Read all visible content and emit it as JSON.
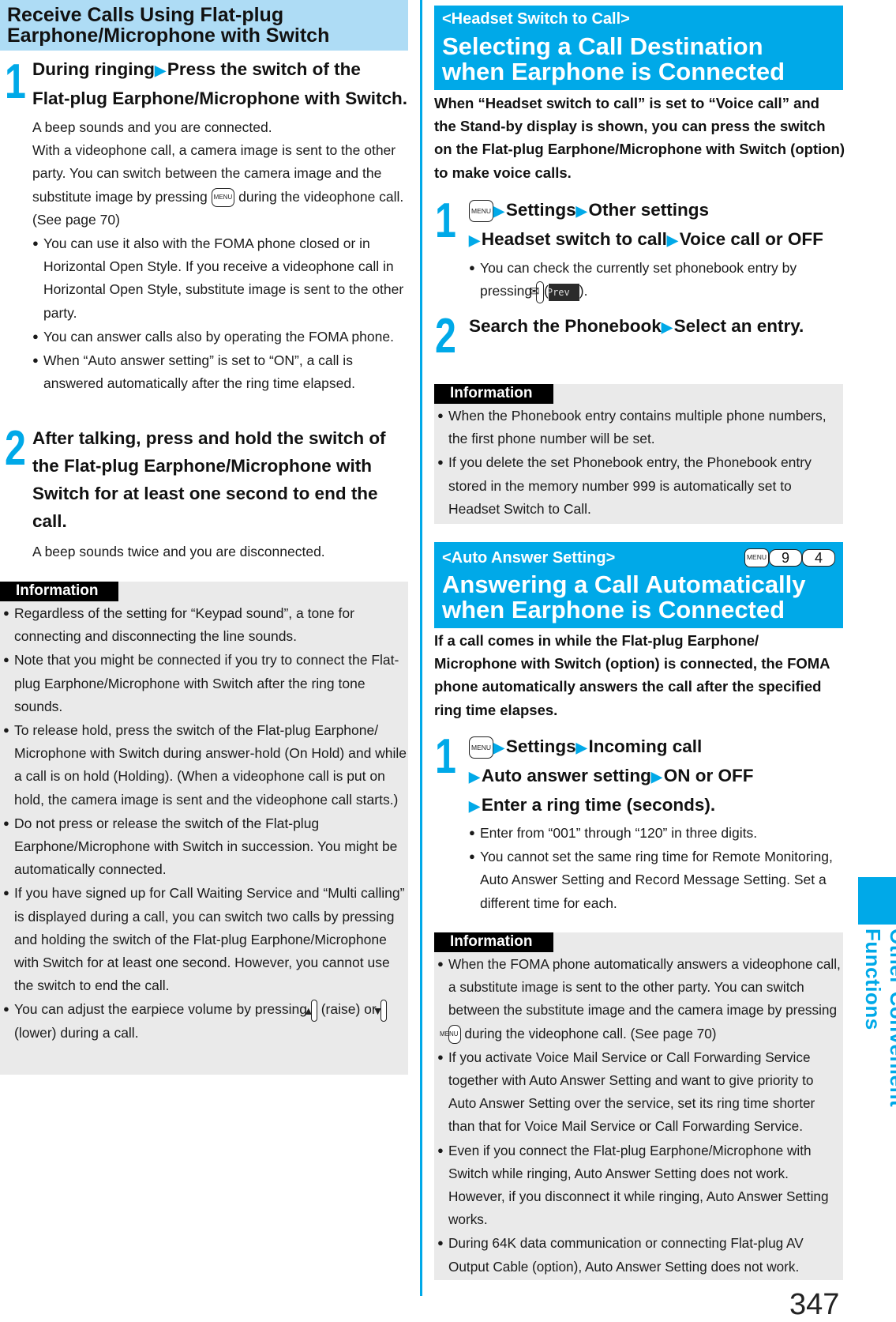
{
  "left": {
    "heading": [
      "Receive Calls Using Flat-plug",
      "Earphone/Microphone with Switch"
    ],
    "step1": {
      "number": "1",
      "line1a": "During ringing",
      "line1b": "Press the switch of the",
      "line2": "Flat-plug Earphone/Microphone with Switch.",
      "para1": "A beep sounds and you are connected.",
      "para2a": "With a videophone call, a camera image is sent to the other party. You can switch between the camera image and the substitute image by pressing",
      "para2b": "during the videophone call. (See page 70)",
      "bullets": [
        "You can use it also with the FOMA phone closed or in Horizontal Open Style. If you receive a videophone call in Horizontal Open Style, substitute image is sent to the other party.",
        "You can answer calls also by operating the FOMA phone.",
        "When “Auto answer setting” is set to “ON”, a call is answered automatically after the ring time elapsed."
      ]
    },
    "step2": {
      "number": "2",
      "text": "After talking, press and hold the switch of the Flat-plug Earphone/Microphone with Switch for at least one second to end the call.",
      "para": "A beep sounds twice and you are disconnected."
    },
    "info": {
      "label": "Information",
      "bullets": [
        "Regardless of the setting for “Keypad sound”, a tone for connecting and disconnecting the line sounds.",
        "Note that you might be connected if you try to connect the Flat-plug Earphone/Microphone with Switch after the ring tone sounds.",
        "To release hold, press the switch of the Flat-plug Earphone/ Microphone with Switch during answer-hold (On Hold) and while a call is on hold (Holding). (When a videophone call is put on hold, the camera image is sent and the videophone call starts.)",
        "Do not press or release the switch of the Flat-plug Earphone/Microphone with Switch in succession. You might be automatically connected.",
        "If you have signed up for Call Waiting Service and “Multi calling” is displayed during a call, you can switch two calls by pressing and holding the switch of the Flat-plug Earphone/Microphone with Switch for at least one second. However, you cannot use the switch to end the call."
      ],
      "last_bullet": {
        "a": "You can adjust the earpiece volume by pressing",
        "b": "(raise) or",
        "c": "(lower) during a call."
      }
    }
  },
  "right": {
    "section1": {
      "subtitle": "<Headset Switch to Call>",
      "title": [
        "Selecting a Call Destination",
        "when Earphone is Connected"
      ],
      "intro": "When “Headset switch to call” is set to “Voice call” and the Stand-by display is shown, you can press the switch on the Flat-plug Earphone/Microphone with Switch (option) to make voice calls.",
      "step1": {
        "number": "1",
        "items": [
          "Settings",
          "Other settings",
          "Headset switch to call",
          "Voice call or OFF"
        ],
        "note_a": "You can check the currently set phonebook entry by pressing",
        "note_softkey": "Prev",
        "note_b": ")."
      },
      "step2": {
        "number": "2",
        "items": [
          "Search the Phonebook",
          "Select an entry."
        ]
      },
      "info": {
        "label": "Information",
        "bullets": [
          "When the Phonebook entry contains multiple phone numbers, the first phone number will be set.",
          "If you delete the set Phonebook entry, the Phonebook entry stored in the memory number 999 is automatically set to Headset Switch to Call."
        ]
      }
    },
    "section2": {
      "subtitle": "<Auto Answer Setting>",
      "shortcut_keys": [
        "MENU",
        "9",
        "4"
      ],
      "title": [
        "Answering a Call Automatically",
        "when Earphone is Connected"
      ],
      "intro": "If a call comes in while the Flat-plug Earphone/ Microphone with Switch (option) is connected, the FOMA phone automatically answers the call after the specified ring time elapses.",
      "step1": {
        "number": "1",
        "items": [
          "Settings",
          "Incoming call",
          "Auto answer setting",
          "ON or OFF",
          "Enter a ring time (seconds)."
        ],
        "bullets": [
          "Enter from “001” through “120” in three digits.",
          "You cannot set the same ring time for Remote Monitoring, Auto Answer Setting and Record Message Setting. Set a different time for each."
        ]
      },
      "info": {
        "label": "Information",
        "first_a": "When the FOMA phone automatically answers a videophone call, a substitute image is sent to the other party. You can switch between the substitute image and the camera image by pressing",
        "first_b": "during the videophone call. (See page 70)",
        "bullets": [
          "If you activate Voice Mail Service or Call Forwarding Service together with Auto Answer Setting and want to give priority to Auto Answer Setting over the service, set its ring time shorter than that for Voice Mail Service or Call Forwarding Service.",
          "Even if you connect the Flat-plug Earphone/Microphone with Switch while ringing, Auto Answer Setting does not work. However, if you disconnect it while ringing, Auto Answer Setting works.",
          "During 64K data communication or connecting Flat-plug AV Output Cable (option), Auto Answer Setting does not work."
        ]
      }
    }
  },
  "keys": {
    "menu": "MENU",
    "mail": "✉",
    "up": "▲",
    "down": "▼"
  },
  "icons": {
    "arrow": "▶",
    "bullet": "●"
  },
  "side_tab": "Other Convenient Functions",
  "page_number": "347",
  "colors": {
    "accent": "#00a9e8",
    "heading_light": "#aedcf5",
    "info_bg": "#eaeaea"
  }
}
